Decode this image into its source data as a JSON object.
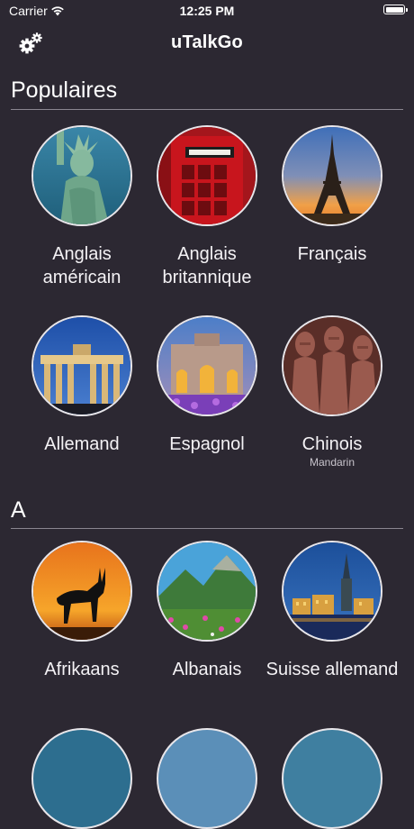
{
  "status_bar": {
    "carrier": "Carrier",
    "time": "12:25 PM"
  },
  "nav": {
    "title": "uTalkGo"
  },
  "sections": {
    "popular": {
      "title": "Populaires",
      "items": [
        {
          "label": "Anglais américain"
        },
        {
          "label": "Anglais britannique"
        },
        {
          "label": "Français"
        },
        {
          "label": "Allemand"
        },
        {
          "label": "Espagnol"
        },
        {
          "label": "Chinois",
          "sublabel": "Mandarin"
        }
      ]
    },
    "a": {
      "title": "A",
      "items": [
        {
          "label": "Afrikaans"
        },
        {
          "label": "Albanais"
        },
        {
          "label": "Suisse allemand"
        }
      ]
    }
  },
  "icons": {
    "wifi": "wifi-icon",
    "battery": "battery-icon",
    "settings": "gears-icon"
  }
}
